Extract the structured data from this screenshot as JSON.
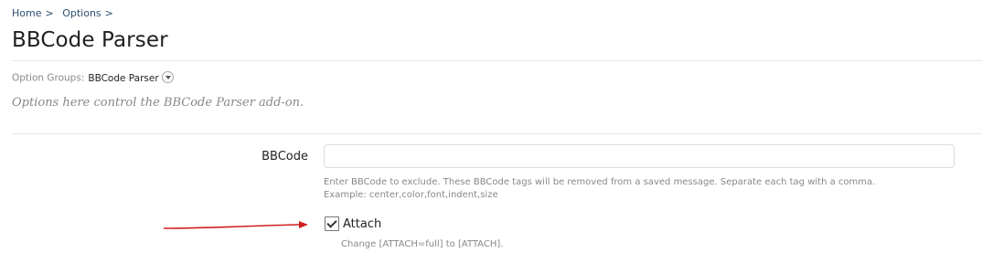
{
  "breadcrumb": [
    {
      "label": "Home",
      "sep": ">"
    },
    {
      "label": "Options",
      "sep": ">"
    }
  ],
  "page": {
    "title": "BBCode Parser"
  },
  "option_groups": {
    "label": "Option Groups:",
    "selected": "BBCode Parser",
    "icon": "chevron-down-icon"
  },
  "description": "Options here control the BBCode Parser add-on.",
  "bbcode_field": {
    "label": "BBCode",
    "value": "",
    "hint_line1": "Enter BBCode to exclude. These BBCode tags will be removed from a saved message. Separate each tag with a comma.",
    "hint_line2": "Example: center,color,font,indent,size"
  },
  "attach_option": {
    "label": "Attach",
    "checked": true,
    "hint": "Change [ATTACH=full] to [ATTACH]."
  },
  "colors": {
    "link": "#2b4c6f",
    "annotation_arrow": "#d02020"
  }
}
